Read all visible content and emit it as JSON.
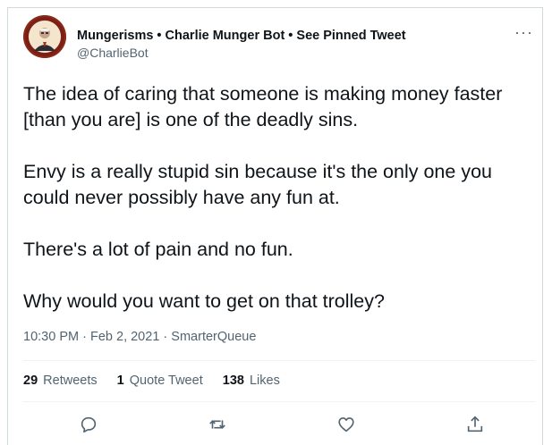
{
  "tweet": {
    "display_name": "Mungerisms • Charlie Munger Bot • See Pinned Tweet",
    "handle": "@CharlieBot",
    "text": [
      "The idea of caring that someone is making money faster [than you are] is one of the deadly sins.",
      "Envy is a really stupid sin because it's the only one you could never possibly have any fun at.",
      "There's a lot of pain and no fun.",
      "Why would you want to get on that trolley?"
    ],
    "time": "10:30 PM",
    "date": "Feb 2, 2021",
    "source": "SmarterQueue",
    "separator": "·",
    "more_label": "···"
  },
  "stats": {
    "retweets_count": "29",
    "retweets_label": "Retweets",
    "quotes_count": "1",
    "quotes_label": "Quote Tweet",
    "likes_count": "138",
    "likes_label": "Likes"
  },
  "icons": {
    "reply": "reply-icon",
    "retweet": "retweet-icon",
    "like": "heart-icon",
    "share": "share-icon",
    "more": "more-icon"
  },
  "colors": {
    "text": "#0f1419",
    "secondary": "#536471",
    "border": "#cfd9de"
  }
}
